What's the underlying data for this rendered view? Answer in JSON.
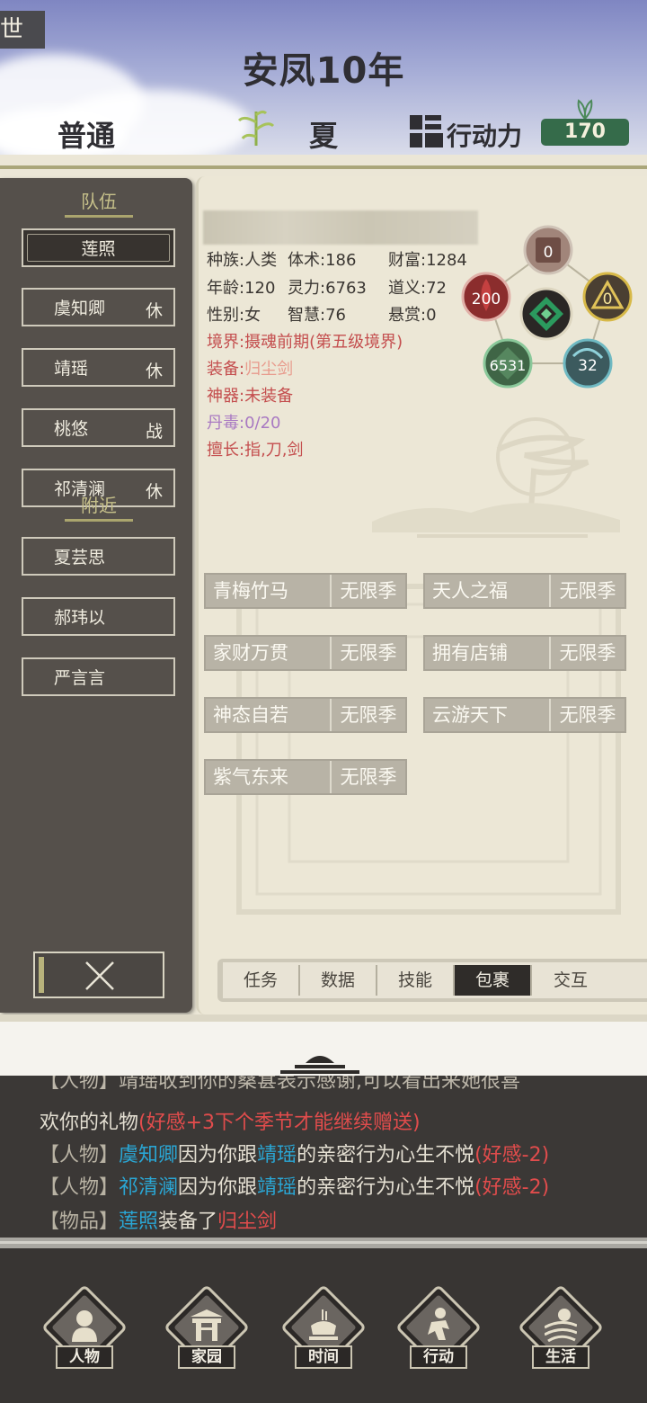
{
  "header": {
    "corner_tag": "世",
    "era_title": "安凤10年",
    "difficulty": "普通",
    "season": "夏",
    "action_points_label": "行动力",
    "action_points_value": "170"
  },
  "sidebar": {
    "team_section": "队伍",
    "nearby_section": "附近",
    "team": [
      {
        "name": "莲照",
        "state": "",
        "selected": true
      },
      {
        "name": "虞知卿",
        "state": "休"
      },
      {
        "name": "靖瑶",
        "state": "休"
      },
      {
        "name": "桃悠",
        "state": "战"
      },
      {
        "name": "祁清澜",
        "state": "休"
      }
    ],
    "nearby": [
      {
        "name": "夏芸思"
      },
      {
        "name": "郝玮以"
      },
      {
        "name": "严言言"
      }
    ]
  },
  "character": {
    "stats": {
      "race": "种族:人类",
      "body": "体术:186",
      "wealth": "财富:1284",
      "age": "年龄:120",
      "spirit": "灵力:6763",
      "morality": "道义:72",
      "gender": "性别:女",
      "wisdom": "智慧:76",
      "bounty": "悬赏:0"
    },
    "realm": "境界:摄魂前期(第五级境界)",
    "equip_prefix": "装备:",
    "equip_value": "归尘剑",
    "artifact": "神器:未装备",
    "poison": "丹毒:0/20",
    "skills": "擅长:指,刀,剑",
    "elements": {
      "top": "0",
      "right": "0",
      "left": "200",
      "bottom_left": "6531",
      "bottom_right": "32"
    },
    "traits": [
      {
        "name": "青梅竹马",
        "duration": "无限季"
      },
      {
        "name": "天人之福",
        "duration": "无限季"
      },
      {
        "name": "家财万贯",
        "duration": "无限季"
      },
      {
        "name": "拥有店铺",
        "duration": "无限季"
      },
      {
        "name": "神态自若",
        "duration": "无限季"
      },
      {
        "name": "云游天下",
        "duration": "无限季"
      },
      {
        "name": "紫气东来",
        "duration": "无限季"
      }
    ]
  },
  "tabs": [
    "任务",
    "数据",
    "技能",
    "包裹",
    "交互"
  ],
  "active_tab": "包裹",
  "log": {
    "partial_line": "【人物】靖瑶收到你的桑葚表示感谢,可以看出来她很喜",
    "line1_a": "欢你的礼物",
    "line1_b": "(好感+3下个季节才能继续赠送)",
    "line2_cat": "【人物】",
    "line2_name": "虞知卿",
    "line2_mid": "因为你跟",
    "line2_target": "靖瑶",
    "line2_tail": "的亲密行为心生不悦",
    "line2_effect": "(好感-2)",
    "line3_cat": "【人物】",
    "line3_name": "祁清澜",
    "line3_mid": "因为你跟",
    "line3_target": "靖瑶",
    "line3_tail": "的亲密行为心生不悦",
    "line3_effect": "(好感-2)",
    "line4_cat": "【物品】",
    "line4_name": "莲照",
    "line4_mid": "装备了",
    "line4_item": "归尘剑"
  },
  "bottom_nav": [
    "人物",
    "家园",
    "时间",
    "行动",
    "生活"
  ],
  "colors": {
    "panel_dark": "#55504b",
    "panel_light": "#ece7d6",
    "ap_green": "#356b4a",
    "log_cyan": "#2aa6d4",
    "log_red": "#e14c4c"
  }
}
